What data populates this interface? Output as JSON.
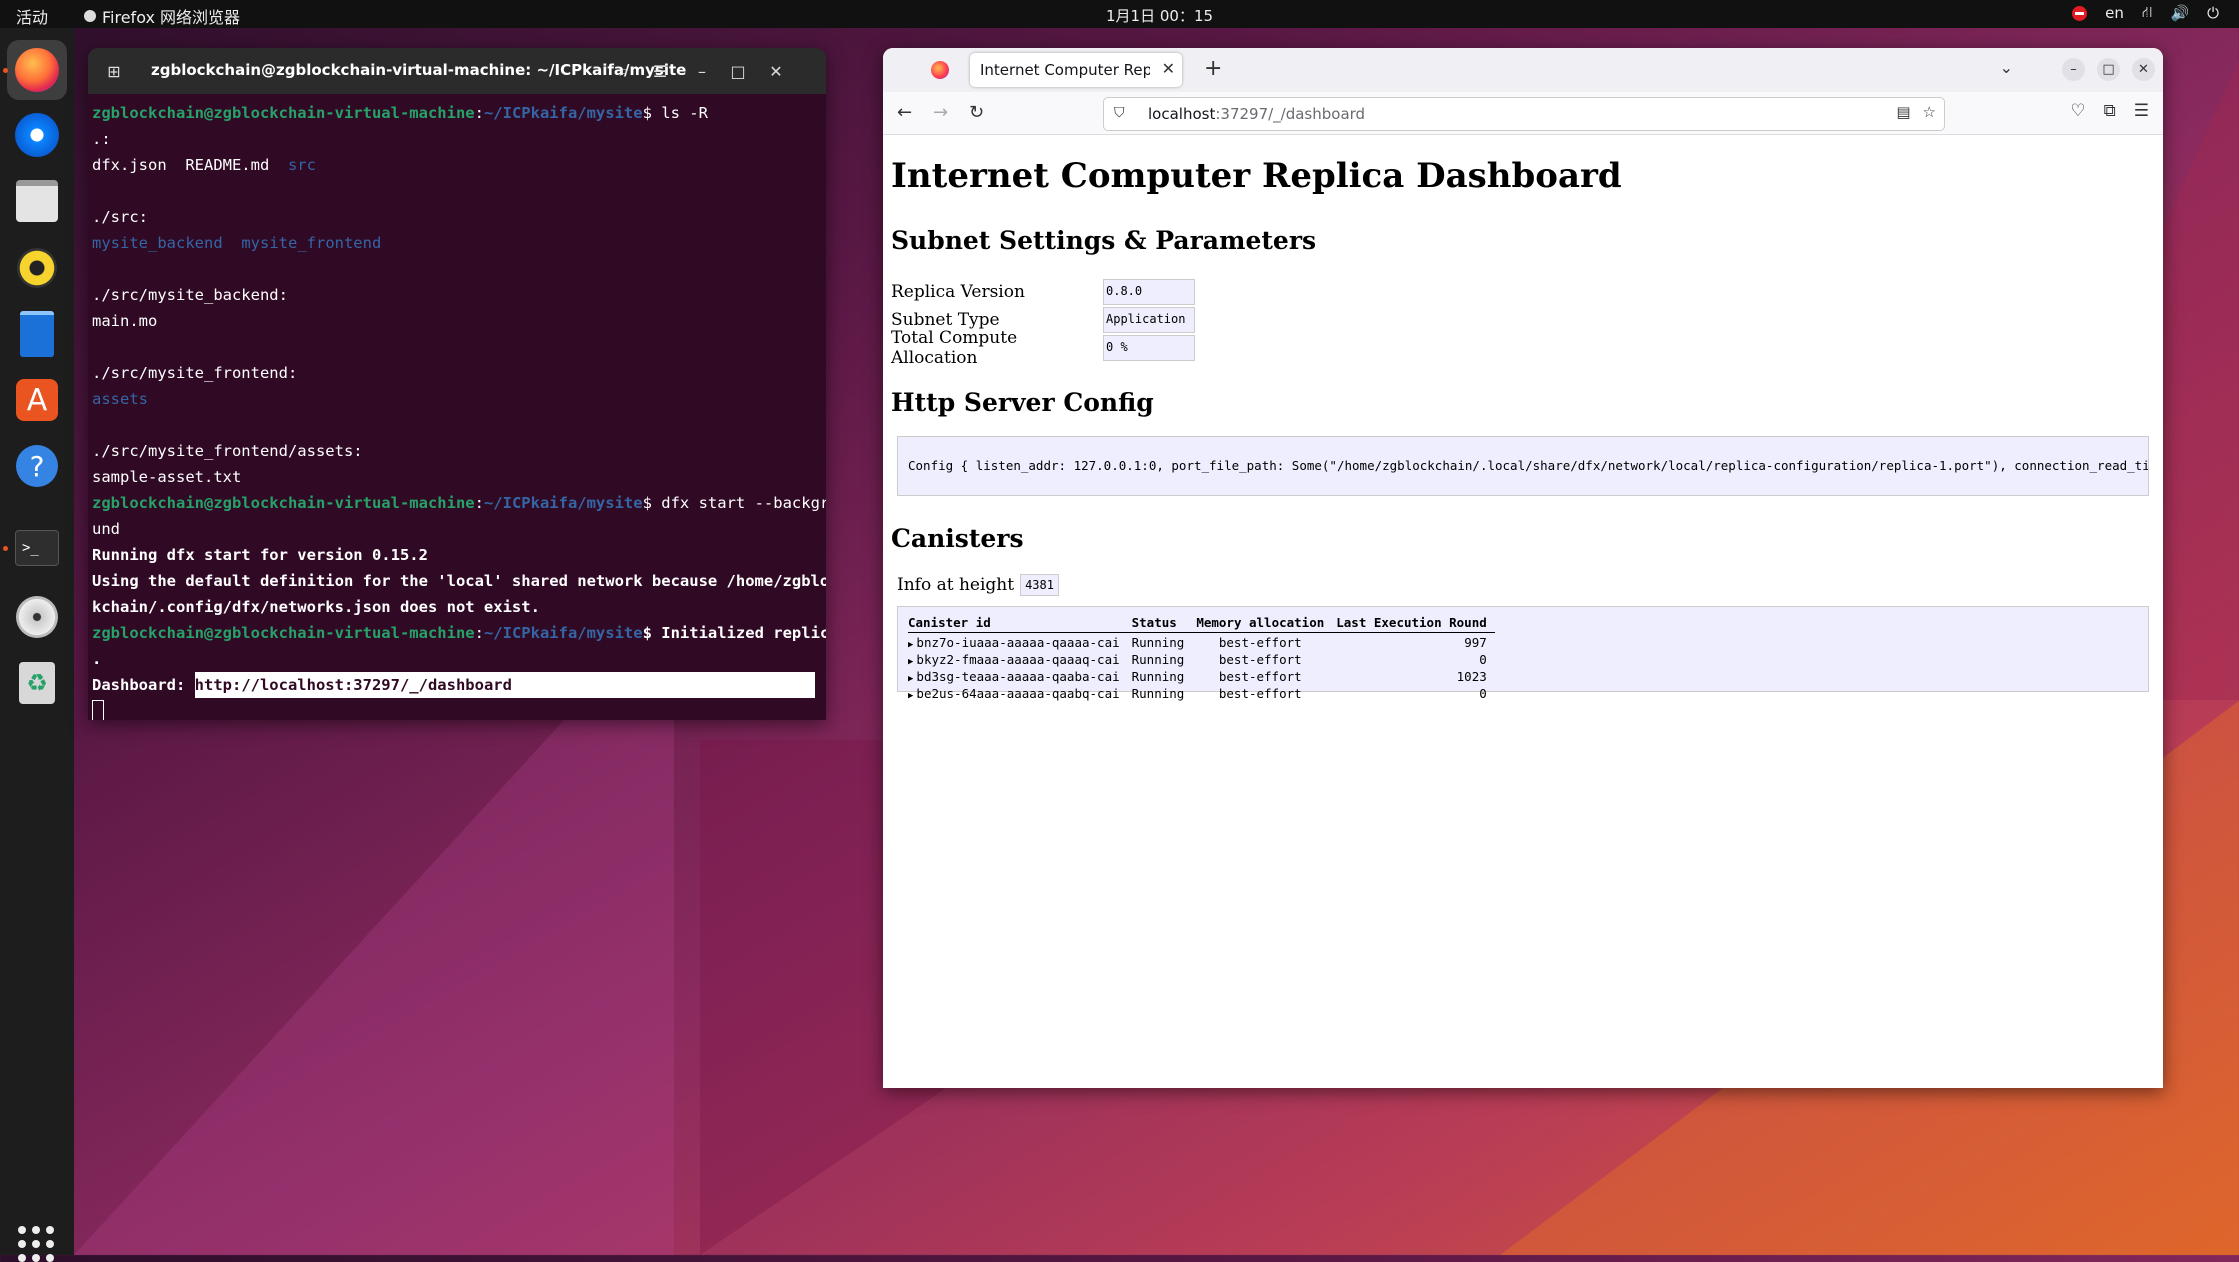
{
  "topbar": {
    "activities": "活动",
    "app_name": "Firefox 网络浏览器",
    "clock": "1月1日  00：15",
    "lang": "en"
  },
  "terminal": {
    "title": "zgblockchain@zgblockchain-virtual-machine: ~/ICPkaifa/mysite",
    "prompt_user": "zgblockchain@zgblockchain-virtual-machine",
    "prompt_path": "~/ICPkaifa/mysite",
    "cmd1": "$ ls -R",
    "l_root": ".:",
    "l_files": "dfx.json  README.md  ",
    "l_src_dir": "src",
    "l_src_head": "./src:",
    "l_backend_dir": "mysite_backend",
    "l_frontend_dir": "mysite_frontend",
    "l_backend_head": "./src/mysite_backend:",
    "l_main": "main.mo",
    "l_frontend_head": "./src/mysite_frontend:",
    "l_assets_dir": "assets",
    "l_assets_head": "./src/mysite_frontend/assets:",
    "l_sample": "sample-asset.txt",
    "cmd2": "$ dfx start --backgro",
    "cmd2_wrap": "und",
    "out1": "Running dfx start for version 0.15.2",
    "out2": "Using the default definition for the 'local' shared network because /home/zgbloc",
    "out2_wrap": "kchain/.config/dfx/networks.json does not exist.",
    "cmd3": "$ Initialized replica",
    "cmd3_wrap": ".",
    "dash_label": "Dashboard: ",
    "dash_url": "http://localhost:37297/_/dashboard"
  },
  "browser": {
    "tab_title": "Internet Computer Replica D",
    "url_host": "localhost",
    "url_rest": ":37297/_/dashboard"
  },
  "page": {
    "h1": "Internet Computer Replica Dashboard",
    "h_subnet": "Subnet Settings & Parameters",
    "settings": [
      {
        "label": "Replica Version",
        "value": "0.8.0"
      },
      {
        "label": "Subnet Type",
        "value": "Application"
      },
      {
        "label": "Total Compute Allocation",
        "value": "0 %"
      }
    ],
    "h_http": "Http Server Config",
    "config_text": "Config { listen_addr: 127.0.0.1:0, port_file_path: Some(\"/home/zgblockchain/.local/share/dfx/network/local/replica-configuration/replica-1.port\"), connection_read_timeout_sec",
    "h_canisters": "Canisters",
    "height_label": "Info at height",
    "height_value": "4381",
    "table_headers": [
      "Canister id",
      "Status",
      "Memory allocation",
      "Last Execution Round"
    ],
    "canisters": [
      {
        "id": "bnz7o-iuaaa-aaaaa-qaaaa-cai",
        "status": "Running",
        "memory": "best-effort",
        "round": "997"
      },
      {
        "id": "bkyz2-fmaaa-aaaaa-qaaaq-cai",
        "status": "Running",
        "memory": "best-effort",
        "round": "0"
      },
      {
        "id": "bd3sg-teaaa-aaaaa-qaaba-cai",
        "status": "Running",
        "memory": "best-effort",
        "round": "1023"
      },
      {
        "id": "be2us-64aaa-aaaaa-qaabq-cai",
        "status": "Running",
        "memory": "best-effort",
        "round": "0"
      }
    ]
  }
}
